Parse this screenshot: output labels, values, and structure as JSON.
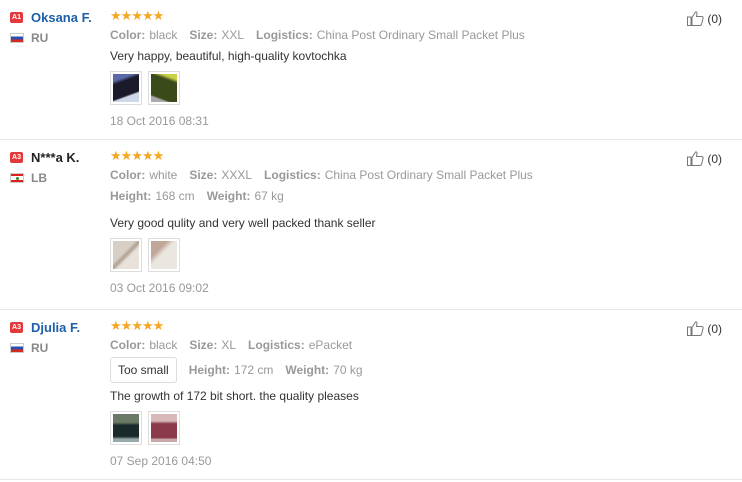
{
  "reviews": [
    {
      "level": "A1",
      "name": "Oksana F.",
      "country": "RU",
      "stars": [
        "★",
        "★",
        "★",
        "★",
        "★"
      ],
      "color_label": "Color:",
      "color": "black",
      "size_label": "Size:",
      "size": "XXL",
      "logistics_label": "Logistics:",
      "logistics": "China Post Ordinary Small Packet Plus",
      "text": "Very happy, beautiful, high-quality kovtochka",
      "date": "18 Oct 2016 08:31",
      "likes": "(0)"
    },
    {
      "level": "A3",
      "name": "N***a K.",
      "country": "LB",
      "stars": [
        "★",
        "★",
        "★",
        "★",
        "★"
      ],
      "color_label": "Color:",
      "color": "white",
      "size_label": "Size:",
      "size": "XXXL",
      "logistics_label": "Logistics:",
      "logistics": "China Post Ordinary Small Packet Plus",
      "height_label": "Height:",
      "height": "168 cm",
      "weight_label": "Weight:",
      "weight": "67 kg",
      "text": "Very good qulity and very well packed thank seller",
      "date": "03 Oct 2016 09:02",
      "likes": "(0)"
    },
    {
      "level": "A3",
      "name": "Djulia F.",
      "country": "RU",
      "stars": [
        "★",
        "★",
        "★",
        "★",
        "★"
      ],
      "color_label": "Color:",
      "color": "black",
      "size_label": "Size:",
      "size": "XL",
      "logistics_label": "Logistics:",
      "logistics": "ePacket",
      "fit_tag": "Too small",
      "height_label": "Height:",
      "height": "172 cm",
      "weight_label": "Weight:",
      "weight": "70 kg",
      "text": "The growth of 172 bit short. the quality pleases",
      "date": "07 Sep 2016 04:50",
      "likes": "(0)"
    }
  ],
  "icons": {
    "like": "thumbs-up-icon",
    "star": "star-icon",
    "flag_ru": "flag-ru-icon",
    "flag_lb": "flag-lb-icon"
  },
  "colors": {
    "star": "#f5a623",
    "username": "#1d5fa8",
    "badge": "#e4393c"
  }
}
